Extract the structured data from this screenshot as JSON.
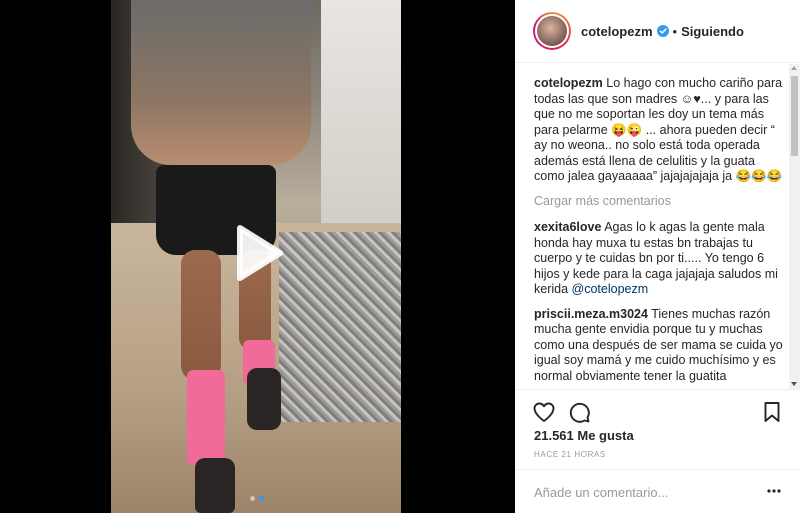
{
  "post": {
    "username": "cotelopezm",
    "separator": "•",
    "follow_status": "Siguiendo",
    "caption": "Lo hago con mucho cariño para todas las que son madres ☺♥... y para las que no me soportan les doy un tema más para pelarme 😝😜 ... ahora pueden decir “ ay no weona.. no solo está toda operada además está llena de celulitis y la guata como jalea gayaaaaa” jajajajajaja ja 😂😂😂",
    "load_more_label": "Cargar más comentarios",
    "comments": [
      {
        "author": "xexita6love",
        "text": "Agas lo k agas la gente mala honda hay muxa tu estas bn trabajas tu cuerpo y te cuidas bn por ti..... Yo tengo 6 hijos y kede para la caga jajajaja saludos mi kerida",
        "mention": "@cotelopezm"
      },
      {
        "author": "priscii.meza.m3024",
        "text": "Tienes muchas razón mucha gente envidia porque tu y muchas como una después de ser mama se cuida yo igual soy mamá y me cuido muchísimo y es normal obviamente tener la guatita"
      }
    ],
    "likes": "21.561 Me gusta",
    "timestamp": "HACE 21 HORAS",
    "comment_placeholder": "Añade un comentario..."
  },
  "media": {
    "type": "video",
    "carousel_total": 2,
    "carousel_active": 2
  },
  "colors": {
    "accent": "#3897f0",
    "text": "#262626",
    "muted": "#999999",
    "verified": "#3897f0"
  },
  "icons": [
    "play-icon",
    "verified-icon",
    "heart-icon",
    "comment-icon",
    "bookmark-icon",
    "more-options-icon"
  ]
}
